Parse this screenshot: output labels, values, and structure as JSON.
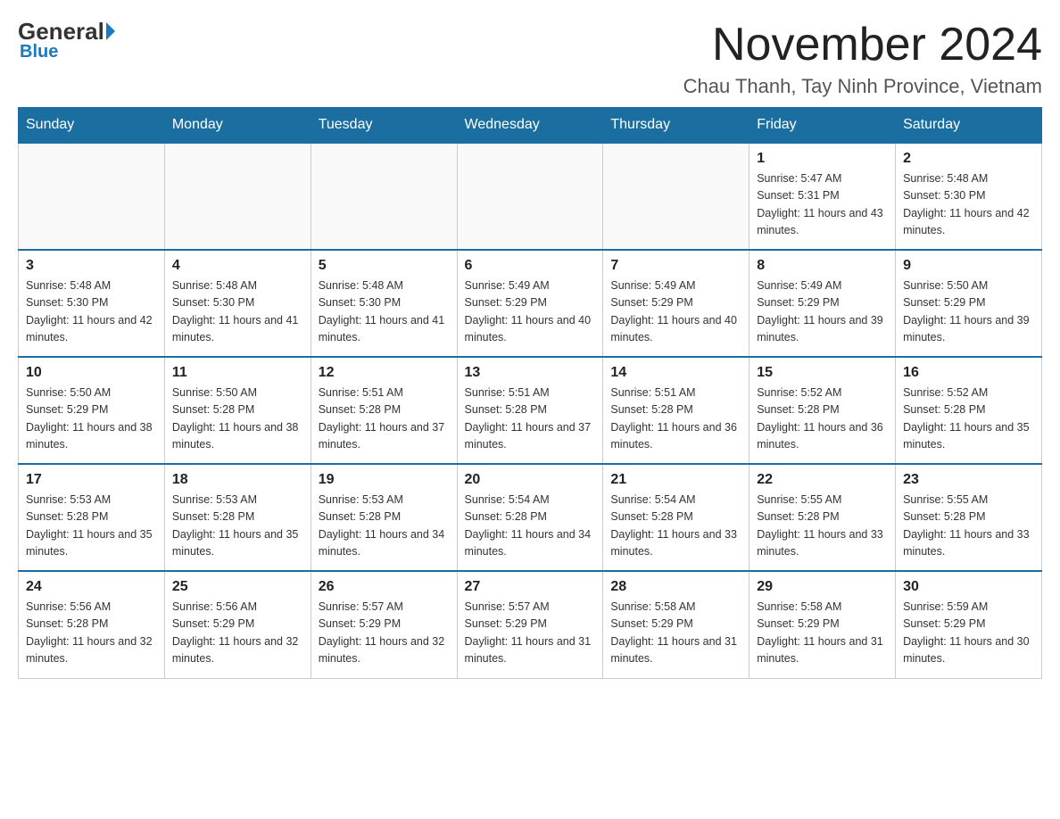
{
  "header": {
    "logo_general": "General",
    "logo_blue": "Blue",
    "month_title": "November 2024",
    "location": "Chau Thanh, Tay Ninh Province, Vietnam"
  },
  "days_of_week": [
    "Sunday",
    "Monday",
    "Tuesday",
    "Wednesday",
    "Thursday",
    "Friday",
    "Saturday"
  ],
  "weeks": [
    {
      "days": [
        {
          "number": "",
          "info": ""
        },
        {
          "number": "",
          "info": ""
        },
        {
          "number": "",
          "info": ""
        },
        {
          "number": "",
          "info": ""
        },
        {
          "number": "",
          "info": ""
        },
        {
          "number": "1",
          "info": "Sunrise: 5:47 AM\nSunset: 5:31 PM\nDaylight: 11 hours and 43 minutes."
        },
        {
          "number": "2",
          "info": "Sunrise: 5:48 AM\nSunset: 5:30 PM\nDaylight: 11 hours and 42 minutes."
        }
      ]
    },
    {
      "days": [
        {
          "number": "3",
          "info": "Sunrise: 5:48 AM\nSunset: 5:30 PM\nDaylight: 11 hours and 42 minutes."
        },
        {
          "number": "4",
          "info": "Sunrise: 5:48 AM\nSunset: 5:30 PM\nDaylight: 11 hours and 41 minutes."
        },
        {
          "number": "5",
          "info": "Sunrise: 5:48 AM\nSunset: 5:30 PM\nDaylight: 11 hours and 41 minutes."
        },
        {
          "number": "6",
          "info": "Sunrise: 5:49 AM\nSunset: 5:29 PM\nDaylight: 11 hours and 40 minutes."
        },
        {
          "number": "7",
          "info": "Sunrise: 5:49 AM\nSunset: 5:29 PM\nDaylight: 11 hours and 40 minutes."
        },
        {
          "number": "8",
          "info": "Sunrise: 5:49 AM\nSunset: 5:29 PM\nDaylight: 11 hours and 39 minutes."
        },
        {
          "number": "9",
          "info": "Sunrise: 5:50 AM\nSunset: 5:29 PM\nDaylight: 11 hours and 39 minutes."
        }
      ]
    },
    {
      "days": [
        {
          "number": "10",
          "info": "Sunrise: 5:50 AM\nSunset: 5:29 PM\nDaylight: 11 hours and 38 minutes."
        },
        {
          "number": "11",
          "info": "Sunrise: 5:50 AM\nSunset: 5:28 PM\nDaylight: 11 hours and 38 minutes."
        },
        {
          "number": "12",
          "info": "Sunrise: 5:51 AM\nSunset: 5:28 PM\nDaylight: 11 hours and 37 minutes."
        },
        {
          "number": "13",
          "info": "Sunrise: 5:51 AM\nSunset: 5:28 PM\nDaylight: 11 hours and 37 minutes."
        },
        {
          "number": "14",
          "info": "Sunrise: 5:51 AM\nSunset: 5:28 PM\nDaylight: 11 hours and 36 minutes."
        },
        {
          "number": "15",
          "info": "Sunrise: 5:52 AM\nSunset: 5:28 PM\nDaylight: 11 hours and 36 minutes."
        },
        {
          "number": "16",
          "info": "Sunrise: 5:52 AM\nSunset: 5:28 PM\nDaylight: 11 hours and 35 minutes."
        }
      ]
    },
    {
      "days": [
        {
          "number": "17",
          "info": "Sunrise: 5:53 AM\nSunset: 5:28 PM\nDaylight: 11 hours and 35 minutes."
        },
        {
          "number": "18",
          "info": "Sunrise: 5:53 AM\nSunset: 5:28 PM\nDaylight: 11 hours and 35 minutes."
        },
        {
          "number": "19",
          "info": "Sunrise: 5:53 AM\nSunset: 5:28 PM\nDaylight: 11 hours and 34 minutes."
        },
        {
          "number": "20",
          "info": "Sunrise: 5:54 AM\nSunset: 5:28 PM\nDaylight: 11 hours and 34 minutes."
        },
        {
          "number": "21",
          "info": "Sunrise: 5:54 AM\nSunset: 5:28 PM\nDaylight: 11 hours and 33 minutes."
        },
        {
          "number": "22",
          "info": "Sunrise: 5:55 AM\nSunset: 5:28 PM\nDaylight: 11 hours and 33 minutes."
        },
        {
          "number": "23",
          "info": "Sunrise: 5:55 AM\nSunset: 5:28 PM\nDaylight: 11 hours and 33 minutes."
        }
      ]
    },
    {
      "days": [
        {
          "number": "24",
          "info": "Sunrise: 5:56 AM\nSunset: 5:28 PM\nDaylight: 11 hours and 32 minutes."
        },
        {
          "number": "25",
          "info": "Sunrise: 5:56 AM\nSunset: 5:29 PM\nDaylight: 11 hours and 32 minutes."
        },
        {
          "number": "26",
          "info": "Sunrise: 5:57 AM\nSunset: 5:29 PM\nDaylight: 11 hours and 32 minutes."
        },
        {
          "number": "27",
          "info": "Sunrise: 5:57 AM\nSunset: 5:29 PM\nDaylight: 11 hours and 31 minutes."
        },
        {
          "number": "28",
          "info": "Sunrise: 5:58 AM\nSunset: 5:29 PM\nDaylight: 11 hours and 31 minutes."
        },
        {
          "number": "29",
          "info": "Sunrise: 5:58 AM\nSunset: 5:29 PM\nDaylight: 11 hours and 31 minutes."
        },
        {
          "number": "30",
          "info": "Sunrise: 5:59 AM\nSunset: 5:29 PM\nDaylight: 11 hours and 30 minutes."
        }
      ]
    }
  ]
}
